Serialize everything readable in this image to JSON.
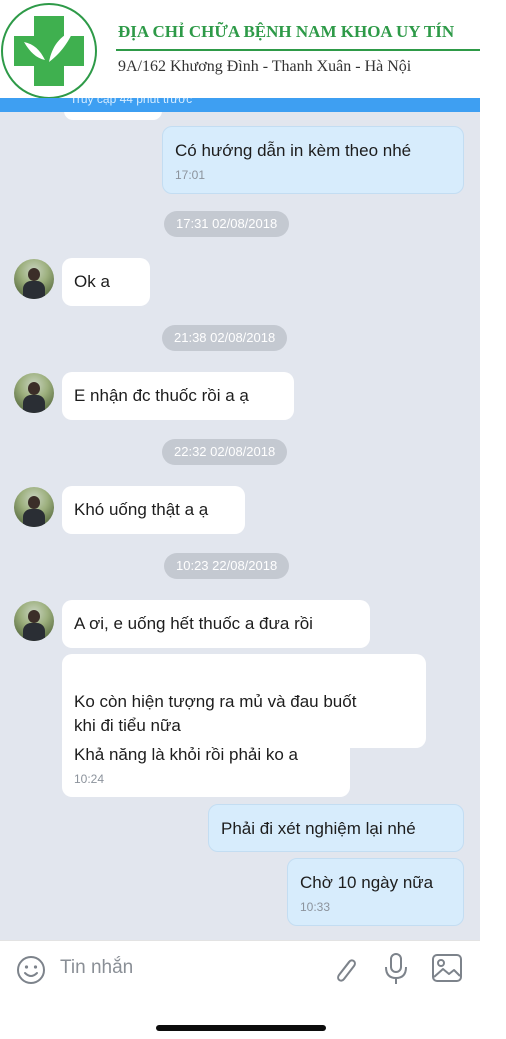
{
  "header": {
    "clinic_name": "ĐỊA CHỈ CHỮA BỆNH NAM KHOA UY TÍN",
    "address": "9A/162 Khương Đình - Thanh Xuân - Hà Nội",
    "status_text": "Truy cập 44 phút trước",
    "brand_color": "#2e9a48",
    "accent_color": "#3e9ff2"
  },
  "messages": [
    {
      "type": "out",
      "text": "Có hướng dẫn in kèm theo nhé",
      "time": "17:01"
    },
    {
      "type": "date",
      "text": "17:31 02/08/2018"
    },
    {
      "type": "in",
      "text": "Ok a"
    },
    {
      "type": "date",
      "text": "21:38 02/08/2018"
    },
    {
      "type": "in",
      "text": "E nhận đc thuốc rồi a ạ"
    },
    {
      "type": "date",
      "text": "22:32 02/08/2018"
    },
    {
      "type": "in",
      "text": "Khó uống thật a ạ"
    },
    {
      "type": "date",
      "text": "10:23 22/08/2018"
    },
    {
      "type": "in",
      "text": "A ơi, e uống hết thuốc a đưa rồi"
    },
    {
      "type": "in",
      "text": "Ko còn hiện tượng ra mủ và đau buốt\nkhi đi tiểu nữa"
    },
    {
      "type": "in",
      "text": "Khả năng là khỏi rồi phải ko a",
      "time": "10:24"
    },
    {
      "type": "out",
      "text": "Phải đi xét nghiệm lại nhé"
    },
    {
      "type": "out",
      "text": "Chờ 10 ngày nữa",
      "time": "10:33"
    }
  ],
  "composer": {
    "placeholder": "Tin nhắn",
    "icons": [
      "emoji-icon",
      "attachment-icon",
      "microphone-icon",
      "image-icon"
    ]
  }
}
